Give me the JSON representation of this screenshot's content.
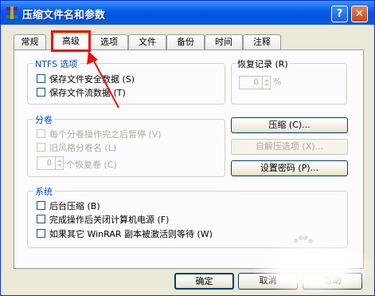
{
  "window": {
    "title": "压缩文件名和参数",
    "help_label": "?",
    "close_label": "✕"
  },
  "tabs": [
    "常规",
    "高级",
    "选项",
    "文件",
    "备份",
    "时间",
    "注释"
  ],
  "active_tab": "高级",
  "ntfs": {
    "title": "NTFS 选项",
    "save_security": "保存文件安全数据 (S)",
    "save_streams": "保存文件流数据 (T)"
  },
  "recovery": {
    "title": "恢复记录 (R)",
    "value": "0",
    "unit": "%"
  },
  "volumes": {
    "title": "分卷",
    "pause_each": "每个分卷操作完之后暂停 (V)",
    "old_naming": "旧风格分卷名 (L)",
    "recovery_count": "0",
    "recovery_volumes": "个恢复卷 (C)"
  },
  "buttons": {
    "compression": "压缩 (C)...",
    "sfx_options": "自解压选项 (X)...",
    "set_password": "设置密码 (P)...",
    "ok": "确定",
    "cancel": "取消",
    "help": "帮助"
  },
  "system": {
    "title": "系统",
    "background": "后台压缩 (B)",
    "shutdown": "完成操作后关闭计算机电源 (F)",
    "wait_other": "如果其它 WinRAR 副本被激活则等待 (W)"
  },
  "colors": {
    "title_bar": "#0054e3",
    "highlight_box": "#e81010",
    "arrow": "#e81010",
    "group_title": "#0046d5"
  }
}
